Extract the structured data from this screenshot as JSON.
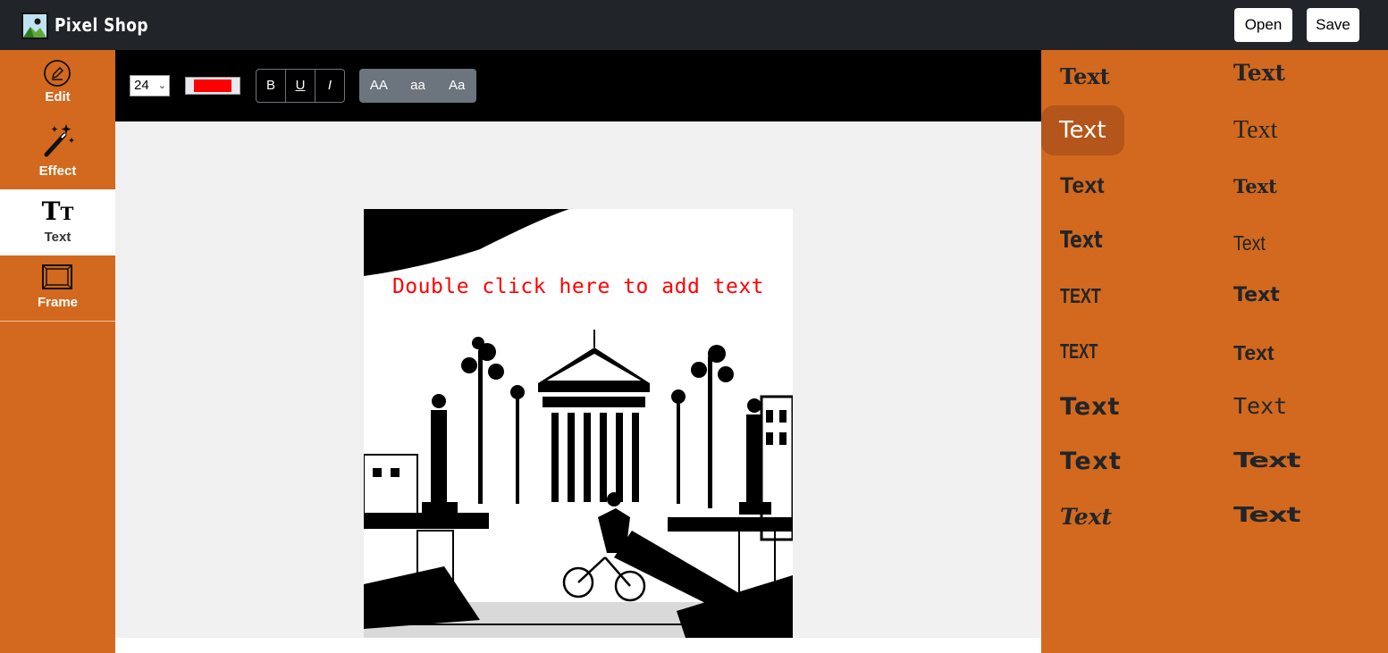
{
  "header": {
    "app_name": "Pixel Shop",
    "open_label": "Open",
    "save_label": "Save",
    "logo_icon": "image-icon"
  },
  "sidebar": {
    "items": [
      {
        "label": "Edit",
        "icon": "pencil-circle-icon",
        "active": false
      },
      {
        "label": "Effect",
        "icon": "magic-wand-icon",
        "active": false
      },
      {
        "label": "Text",
        "icon": "text-size-icon",
        "active": true
      },
      {
        "label": "Frame",
        "icon": "frame-icon",
        "active": false
      }
    ]
  },
  "toolbar": {
    "font_size": "24",
    "text_color": "#ff0000",
    "bold_label": "B",
    "underline_label": "U",
    "italic_label": "I",
    "uppercase_label": "AA",
    "lowercase_label": "aa",
    "capitalize_label": "Aa"
  },
  "canvas": {
    "overlay_text": "Double click here to add text",
    "image_description": "black and white photo"
  },
  "font_panel": {
    "options": [
      {
        "label": "Text",
        "selected": false
      },
      {
        "label": "Text",
        "selected": false
      },
      {
        "label": "Text",
        "selected": true
      },
      {
        "label": "Text",
        "selected": false
      },
      {
        "label": "Text",
        "selected": false
      },
      {
        "label": "Text",
        "selected": false
      },
      {
        "label": "Text",
        "selected": false
      },
      {
        "label": "Text",
        "selected": false
      },
      {
        "label": "TEXT",
        "selected": false
      },
      {
        "label": "Text",
        "selected": false
      },
      {
        "label": "TEXT",
        "selected": false
      },
      {
        "label": "Text",
        "selected": false
      },
      {
        "label": "Text",
        "selected": false
      },
      {
        "label": "Text",
        "selected": false
      },
      {
        "label": "Text",
        "selected": false
      },
      {
        "label": "Text",
        "selected": false
      },
      {
        "label": "Text",
        "selected": false
      },
      {
        "label": "Text",
        "selected": false
      }
    ]
  },
  "colors": {
    "accent": "#d2691e",
    "topbar": "#212529",
    "canvas_bg": "#f0f0f0"
  }
}
